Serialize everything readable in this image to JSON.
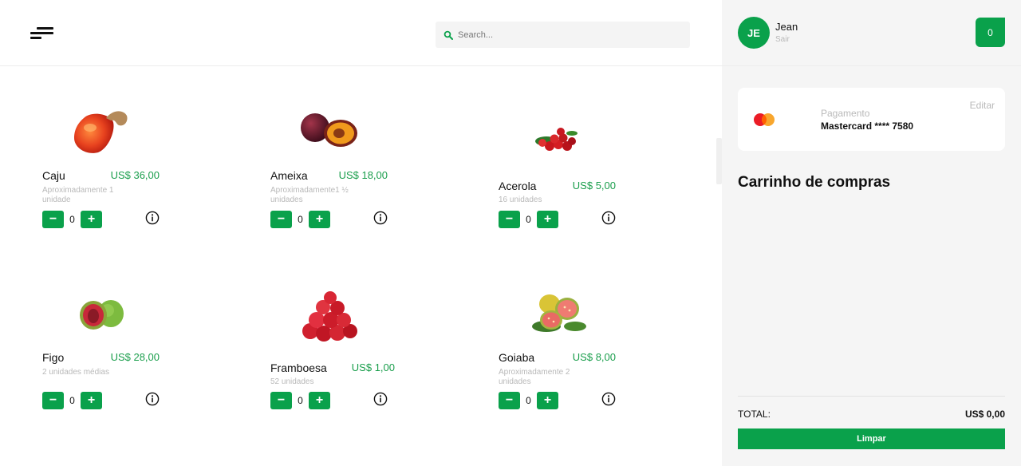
{
  "header": {
    "search_placeholder": "Search..."
  },
  "products": [
    {
      "name": "Caju",
      "price": "US$ 36,00",
      "desc": "Aproximadamente 1 unidade",
      "qty": "0",
      "image": "cashew-fruit"
    },
    {
      "name": "Ameixa",
      "price": "US$ 18,00",
      "desc": "Aproximadamente1 ½ unidades",
      "qty": "0",
      "image": "plum"
    },
    {
      "name": "Acerola",
      "price": "US$ 5,00",
      "desc": "16 unidades",
      "qty": "0",
      "image": "acerola-cherries"
    },
    {
      "name": "Figo",
      "price": "US$ 28,00",
      "desc": "2 unidades médias",
      "qty": "0",
      "image": "fig"
    },
    {
      "name": "Framboesa",
      "price": "US$ 1,00",
      "desc": "52 unidades",
      "qty": "0",
      "image": "raspberries"
    },
    {
      "name": "Goiaba",
      "price": "US$ 8,00",
      "desc": "Aproximadamente 2 unidades",
      "qty": "0",
      "image": "guava"
    }
  ],
  "controls": {
    "minus": "−",
    "plus": "+"
  },
  "user": {
    "initials": "JE",
    "name": "Jean",
    "logout": "Sair"
  },
  "cart": {
    "count": "0",
    "title": "Carrinho de compras"
  },
  "payment": {
    "label": "Pagamento",
    "card": "Mastercard **** 7580",
    "edit": "Editar"
  },
  "totals": {
    "label": "TOTAL:",
    "value": "US$ 0,00",
    "clear": "Limpar"
  },
  "colors": {
    "accent": "#0aa14b",
    "price": "#1a9e4c",
    "muted": "#b9b9b9",
    "sidebar_bg": "#f5f5f5"
  }
}
